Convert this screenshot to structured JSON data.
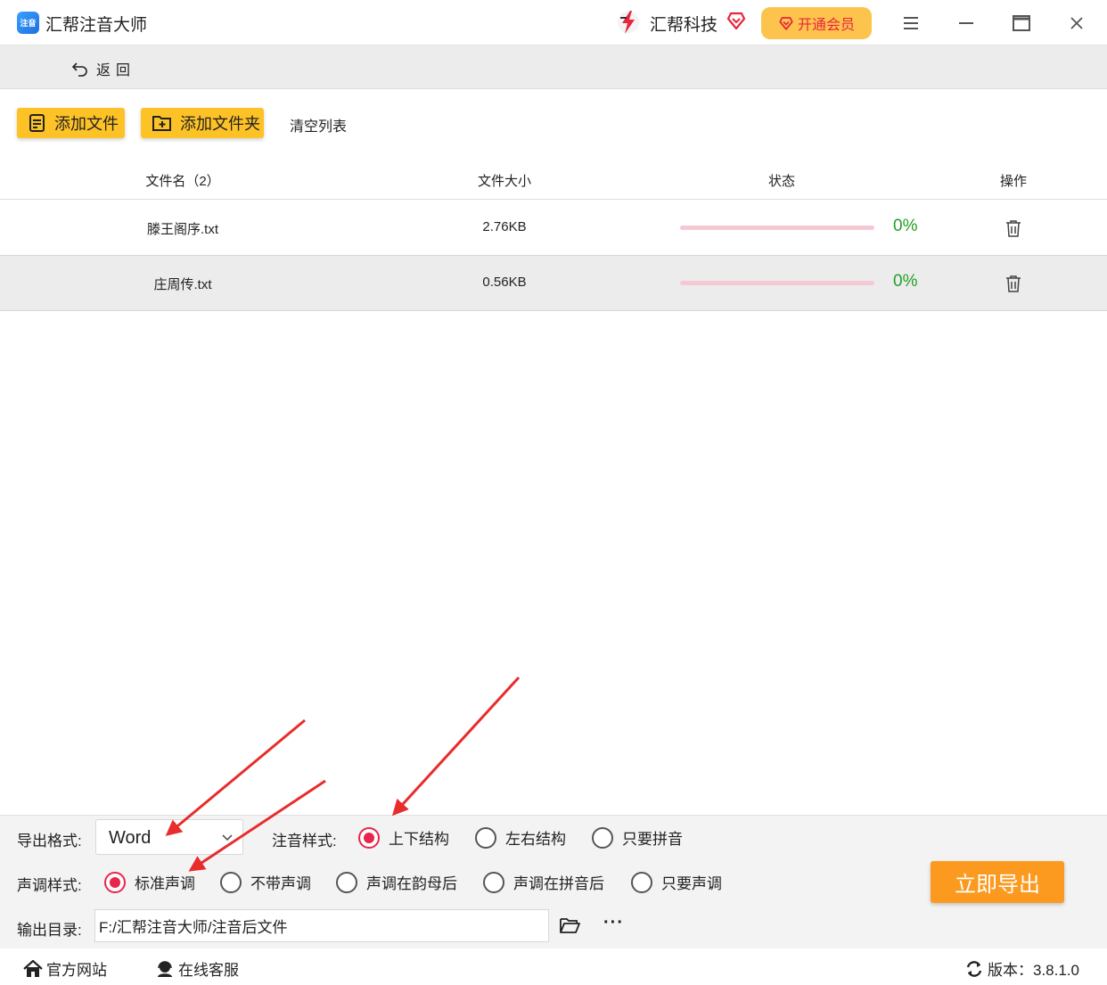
{
  "titlebar": {
    "app_logo_text": "注音",
    "app_title": "汇帮注音大师",
    "brand_name": "汇帮科技",
    "vip_label": "开通会员"
  },
  "backbar": {
    "back_label": "返回"
  },
  "toolbar": {
    "add_file": "添加文件",
    "add_folder": "添加文件夹",
    "clear_list": "清空列表"
  },
  "table": {
    "headers": {
      "name": "文件名（2）",
      "size": "文件大小",
      "status": "状态",
      "action": "操作"
    },
    "rows": [
      {
        "name": "滕王阁序.txt",
        "size": "2.76KB",
        "progress": 0,
        "progress_label": "0%"
      },
      {
        "name": "庄周传.txt",
        "size": "0.56KB",
        "progress": 0,
        "progress_label": "0%"
      }
    ]
  },
  "settings": {
    "export_format_label": "导出格式:",
    "export_format_value": "Word",
    "style_label": "注音样式:",
    "style_options": [
      {
        "label": "上下结构",
        "checked": true
      },
      {
        "label": "左右结构",
        "checked": false
      },
      {
        "label": "只要拼音",
        "checked": false
      }
    ],
    "tone_label": "声调样式:",
    "tone_options": [
      {
        "label": "标准声调",
        "checked": true
      },
      {
        "label": "不带声调",
        "checked": false
      },
      {
        "label": "声调在韵母后",
        "checked": false
      },
      {
        "label": "声调在拼音后",
        "checked": false
      },
      {
        "label": "只要声调",
        "checked": false
      }
    ],
    "output_dir_label": "输出目录:",
    "output_dir_value": "F:/汇帮注音大师/注音后文件",
    "more_label": "···",
    "export_button": "立即导出"
  },
  "footer": {
    "official_site": "官方网站",
    "online_service": "在线客服",
    "version": "版本：3.8.1.0"
  },
  "colors": {
    "accent_yellow": "#fdc226",
    "export_orange": "#fb9a1f",
    "radio_red": "#e8254a",
    "progress_pink": "#f4c9d4",
    "percent_green": "#22a022",
    "annotation_red": "#e82c2c"
  }
}
